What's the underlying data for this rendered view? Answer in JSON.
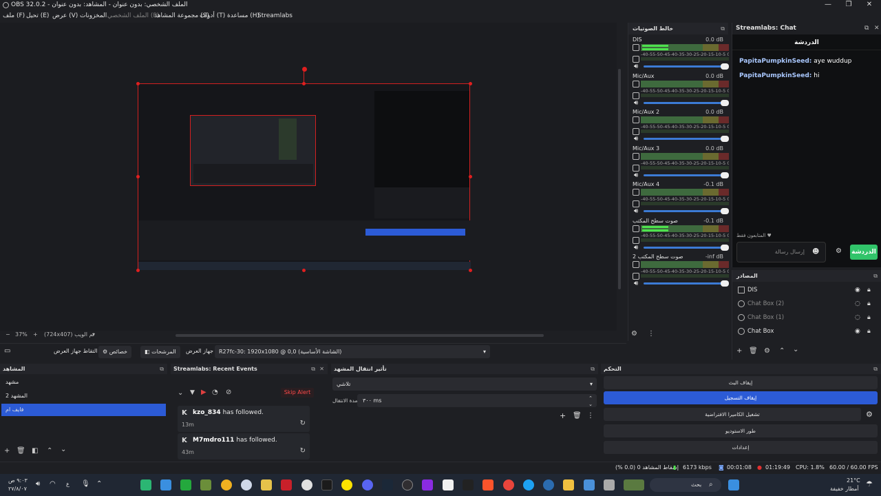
{
  "window": {
    "title": "OBS 32.0.2 - الملف الشخصي: بدون عنوان - المشاهد: بدون عنوان",
    "minimize": "—",
    "maximize": "❐",
    "close": "✕"
  },
  "menu": {
    "file": "ملف (F)",
    "edit": "تحيل (E)",
    "view": "عرض (V)",
    "docks": "المخزونات",
    "profile": "الملف الشخصي (P)",
    "scene_collection": "مجموعة المشاهد (S)",
    "tools": "أدوات (T)",
    "help": "مساعدة (H)",
    "streamlabs": "Streamlabs"
  },
  "preview": {
    "zoom": "37%",
    "resolution": "(724x407) ثم الويب"
  },
  "source_bar": {
    "capture_label": "التقاط جهاز العرض",
    "properties_label": "خصائص",
    "filters_label": "المرشحات",
    "display_label": "جهاز العرض",
    "display_value": "R27fc-30: 1920x1080 @ 0,0 (الشاشة الأساسية)"
  },
  "mixer": {
    "title": "خالط الصوتيات",
    "scale_text": "-40-55-50-45-40-35-30-25-20-15-10-5 0",
    "channels": [
      {
        "name": "DIS",
        "db": "0.0 dB",
        "level": 0.3
      },
      {
        "name": "Mic/Aux",
        "db": "0.0 dB",
        "level": 0
      },
      {
        "name": "Mic/Aux 2",
        "db": "0.0 dB",
        "level": 0
      },
      {
        "name": "Mic/Aux 3",
        "db": "0.0 dB",
        "level": 0
      },
      {
        "name": "Mic/Aux 4",
        "db": "-0.1 dB",
        "level": 0
      },
      {
        "name": "صوت سطح المكتب",
        "db": "-0.1 dB",
        "level": 0.3
      },
      {
        "name": "صوت سطح المكتب 2",
        "db": "-inf dB",
        "level": 0
      }
    ]
  },
  "chat": {
    "header": "Streamlabs: Chat",
    "tab_title": "الدردشة",
    "messages": [
      {
        "user": "PapitaPumpkinSeed:",
        "text": " aye wuddup"
      },
      {
        "user": "PapitaPumpkinSeed:",
        "text": " hi"
      }
    ],
    "mods_only": "المتابعون فقط ♥",
    "input_placeholder": "إرسال رسالة",
    "send_label": "الدردشة"
  },
  "sources": {
    "title": "المصادر",
    "items": [
      {
        "name": "DIS",
        "visible": true
      },
      {
        "name": "Chat Box (2)",
        "visible": false
      },
      {
        "name": "Chat Box (1)",
        "visible": false
      },
      {
        "name": "Chat Box",
        "visible": true
      }
    ]
  },
  "scenes": {
    "title": "المشاهد",
    "items": [
      "مشهد",
      "المشهد 2",
      "فايف ام"
    ],
    "selected_index": 2
  },
  "events": {
    "title": "Streamlabs: Recent Events",
    "skip_label": "Skip Alert",
    "items": [
      {
        "user": "kzo_834",
        "action": " has followed.",
        "time": "13m"
      },
      {
        "user": "M7mdro111",
        "action": " has followed.",
        "time": "43m"
      }
    ]
  },
  "transitions": {
    "title": "تأثير انتقال المشهد",
    "type": "تلاشي",
    "duration_label": "مدة الانتقال",
    "duration_value": "٣٠٠ ms"
  },
  "controls": {
    "title": "التحكم",
    "buttons": [
      "إيقاف البث",
      "إيقاف التسجيل",
      "تشغيل الكاميرا الافتراضية",
      "طور الاستوديو",
      "إعدادات"
    ],
    "active_index": 1
  },
  "status": {
    "dropped": "إسقاط المشاهد 0 (0.0 %)",
    "bitrate": "6173 kbps",
    "stream_time": "00:01:08",
    "rec_time": "01:19:49",
    "cpu": "CPU: 1.8%",
    "fps": "60.00 / 60.00 FPS"
  },
  "taskbar": {
    "time": "٩:٠٣ ص",
    "date": "٢٧/٨/٠٧",
    "lang": "ع",
    "weather_temp": "21°C",
    "weather_desc": "أمطار خفيفة",
    "search": "بحث"
  }
}
